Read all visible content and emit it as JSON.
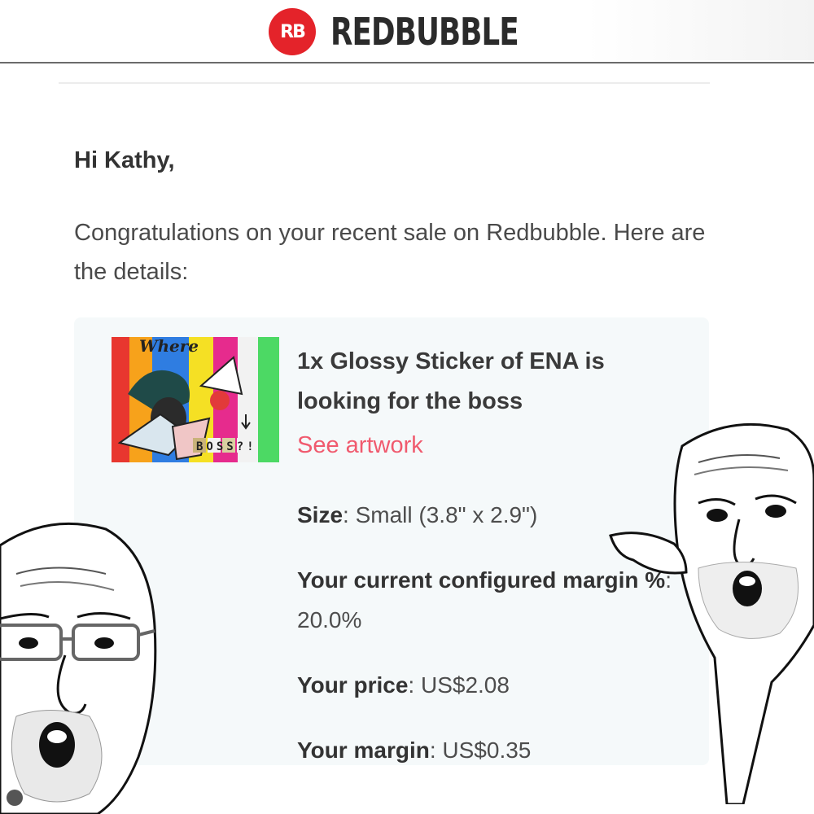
{
  "brand": {
    "badge": "RB",
    "name": "REDBUBBLE"
  },
  "email": {
    "greeting": "Hi Kathy,",
    "intro": "Congratulations on your recent sale on Redbubble. Here are the details:",
    "product": {
      "title": "1x Glossy Sticker of ENA is looking for the boss",
      "link_label": "See artwork",
      "artwork_texts": {
        "top": "Where",
        "bottom": "BOSS?!"
      }
    },
    "details": {
      "size_label": "Size",
      "size_value": "Small (3.8\" x 2.9\")",
      "margin_pct_label": "Your current configured margin %",
      "margin_pct_value": "20.0%",
      "price_label": "Your price",
      "price_value": "US$2.08",
      "margin_label": "Your margin",
      "margin_value": "US$0.35"
    }
  },
  "colors": {
    "brand_red": "#e4232a",
    "link_pink": "#f05a6e",
    "card_bg": "#f5f9fa"
  }
}
